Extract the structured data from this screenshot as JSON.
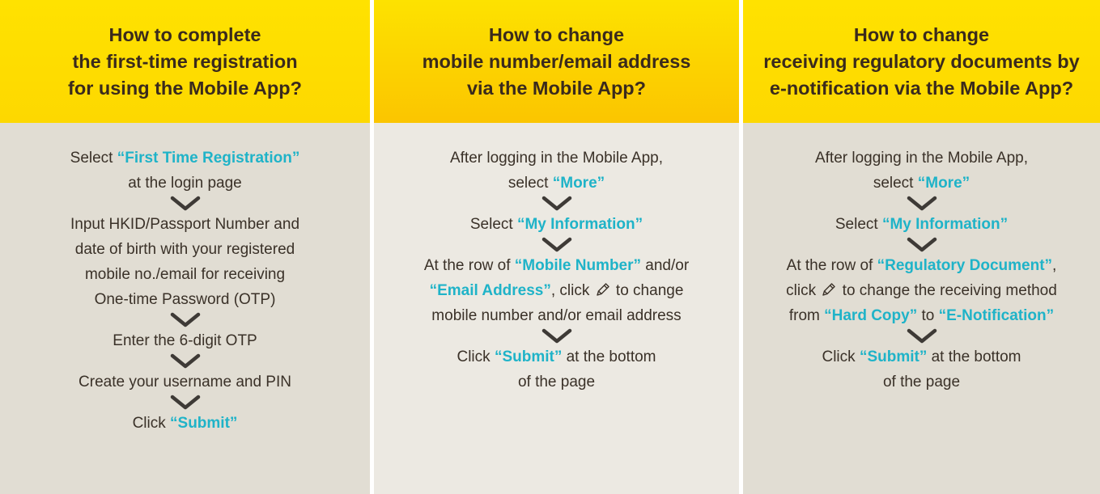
{
  "colors": {
    "header_yellow": "#ffe200",
    "header_amber": "#fbc500",
    "body_beige": "#e1ddd3",
    "body_light": "#ece9e2",
    "highlight": "#1fb3c8",
    "text": "#3a3128",
    "title_text": "#3a2a1c"
  },
  "columns": [
    {
      "title_lines": [
        "How to complete",
        "the first-time registration",
        "for using the Mobile App?"
      ],
      "steps": [
        {
          "lines": [
            [
              {
                "t": "Select "
              },
              {
                "t": "“First Time Registration”",
                "h": true
              }
            ],
            [
              {
                "t": "at the login page"
              }
            ]
          ]
        },
        {
          "lines": [
            [
              {
                "t": "Input HKID/Passport Number and"
              }
            ],
            [
              {
                "t": "date of birth with your registered"
              }
            ],
            [
              {
                "t": "mobile no./email for receiving"
              }
            ],
            [
              {
                "t": "One-time Password (OTP)"
              }
            ]
          ]
        },
        {
          "lines": [
            [
              {
                "t": "Enter the 6-digit OTP"
              }
            ]
          ]
        },
        {
          "lines": [
            [
              {
                "t": "Create your username and PIN"
              }
            ]
          ]
        },
        {
          "lines": [
            [
              {
                "t": "Click "
              },
              {
                "t": "“Submit”",
                "h": true
              }
            ]
          ]
        }
      ]
    },
    {
      "title_lines": [
        "How to change",
        "mobile number/email address",
        "via the Mobile App?"
      ],
      "steps": [
        {
          "lines": [
            [
              {
                "t": "After logging in the Mobile App,"
              }
            ],
            [
              {
                "t": "select "
              },
              {
                "t": "“More”",
                "h": true
              }
            ]
          ]
        },
        {
          "lines": [
            [
              {
                "t": "Select "
              },
              {
                "t": "“My Information”",
                "h": true
              }
            ]
          ]
        },
        {
          "lines": [
            [
              {
                "t": "At the row of "
              },
              {
                "t": "“Mobile Number”",
                "h": true
              },
              {
                "t": " and/or"
              }
            ],
            [
              {
                "t": "“Email Address”",
                "h": true
              },
              {
                "t": ", click "
              },
              {
                "icon": "pencil-icon"
              },
              {
                "t": " to change"
              }
            ],
            [
              {
                "t": "mobile number and/or email address"
              }
            ]
          ]
        },
        {
          "lines": [
            [
              {
                "t": "Click "
              },
              {
                "t": "“Submit”",
                "h": true
              },
              {
                "t": " at the bottom"
              }
            ],
            [
              {
                "t": "of the page"
              }
            ]
          ]
        }
      ]
    },
    {
      "title_lines": [
        "How to change",
        "receiving regulatory documents by",
        "e-notification via the Mobile App?"
      ],
      "steps": [
        {
          "lines": [
            [
              {
                "t": "After logging in the Mobile App,"
              }
            ],
            [
              {
                "t": "select "
              },
              {
                "t": "“More”",
                "h": true
              }
            ]
          ]
        },
        {
          "lines": [
            [
              {
                "t": "Select "
              },
              {
                "t": "“My Information”",
                "h": true
              }
            ]
          ]
        },
        {
          "lines": [
            [
              {
                "t": "At the row of "
              },
              {
                "t": "“Regulatory Document”",
                "h": true
              },
              {
                "t": ","
              }
            ],
            [
              {
                "t": "click "
              },
              {
                "icon": "pencil-icon"
              },
              {
                "t": " to change the receiving method"
              }
            ],
            [
              {
                "t": "from "
              },
              {
                "t": "“Hard Copy”",
                "h": true
              },
              {
                "t": " to "
              },
              {
                "t": "“E-Notification”",
                "h": true
              }
            ]
          ]
        },
        {
          "lines": [
            [
              {
                "t": "Click "
              },
              {
                "t": "“Submit”",
                "h": true
              },
              {
                "t": " at the bottom"
              }
            ],
            [
              {
                "t": "of the page"
              }
            ]
          ]
        }
      ]
    }
  ]
}
